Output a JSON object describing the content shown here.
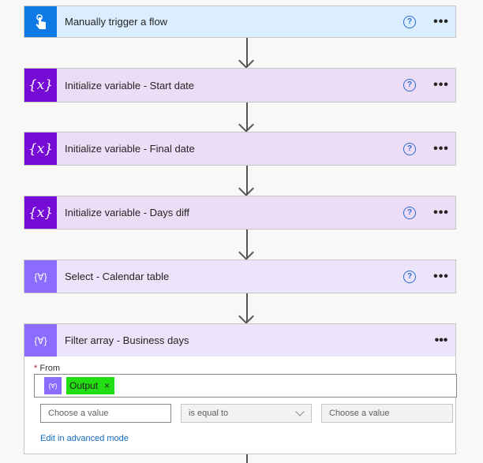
{
  "steps": [
    {
      "title": "Manually trigger a flow",
      "icon": "hand-tap-icon",
      "help": "?",
      "more": "•••"
    },
    {
      "title": "Initialize variable - Start date",
      "icon_text": "{x}",
      "help": "?",
      "more": "•••"
    },
    {
      "title": "Initialize variable - Final date",
      "icon_text": "{x}",
      "help": "?",
      "more": "•••"
    },
    {
      "title": "Initialize variable - Days diff",
      "icon_text": "{x}",
      "help": "?",
      "more": "•••"
    },
    {
      "title": "Select - Calendar table",
      "icon_text": "{∀}",
      "help": "?",
      "more": "•••"
    }
  ],
  "filter": {
    "title": "Filter array - Business days",
    "icon_text": "{∀}",
    "more": "•••",
    "from_required": "*",
    "from_label": "From",
    "token_icon": "{∀}",
    "token_label": "Output",
    "token_remove": "×",
    "left_placeholder": "Choose a value",
    "operator": "is equal to",
    "right_placeholder": "Choose a value",
    "advanced_link": "Edit in advanced mode"
  },
  "colors": {
    "trigger_bg": "#dbeeff",
    "trigger_icon": "#0f7ae5",
    "variable_bg": "#ecdcf6",
    "variable_icon": "#770bd6",
    "data_op_bg": "#ebe4fb",
    "data_op_icon": "#8c6cff",
    "token_highlight": "#22dd11"
  }
}
